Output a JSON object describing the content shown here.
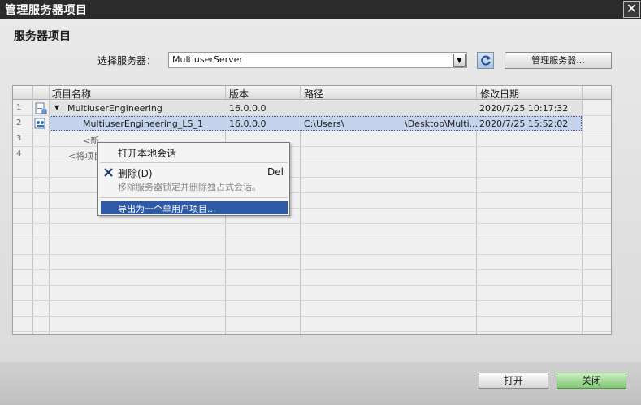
{
  "window": {
    "title": "管理服务器项目",
    "close_glyph": "✕"
  },
  "section_title": "服务器项目",
  "server": {
    "label": "选择服务器：",
    "value": "MultiuserServer",
    "dropdown_glyph": "▼"
  },
  "buttons": {
    "manage": "管理服务器...",
    "open": "打开",
    "close": "关闭"
  },
  "colors": {
    "title_bar": "#2b2b2b",
    "selection": "#2d5aa5",
    "close_button": "#7fc573"
  },
  "table": {
    "headers": [
      "项目名称",
      "版本",
      "路径",
      "修改日期"
    ],
    "row_numbers": [
      "1",
      "2",
      "3",
      "4"
    ],
    "rows": [
      {
        "icon": "project-icon",
        "expand_glyph": "▼",
        "name": "MultiuserEngineering",
        "version": "16.0.0.0",
        "path": "",
        "modified": "2020/7/25 10:17:32"
      },
      {
        "icon": "local-session-icon",
        "name": "MultiuserEngineering_LS_1",
        "version": "16.0.0.0",
        "path_prefix": "C:\\Users\\",
        "path_suffix": "\\Desktop\\Multi...",
        "modified": "2020/7/25 15:52:02"
      },
      {
        "name": "<新"
      },
      {
        "name": "<将项目"
      }
    ]
  },
  "context_menu": {
    "items": [
      {
        "label": "打开本地会话"
      },
      {
        "label": "删除(D)",
        "shortcut": "Del",
        "icon": "delete-x-icon",
        "description": "移除服务器锁定并删除独占式会话。"
      },
      {
        "label": "导出为一个单用户项目..."
      }
    ]
  }
}
